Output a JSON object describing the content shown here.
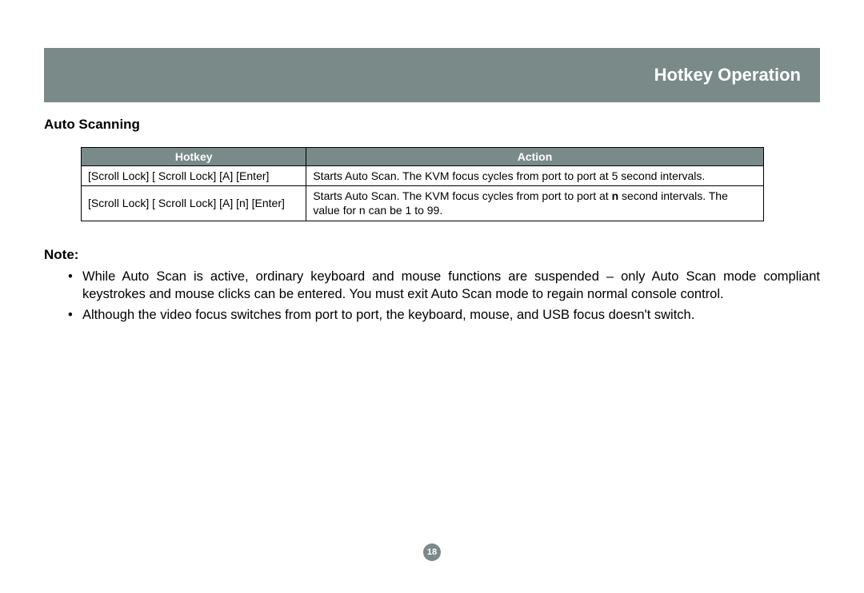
{
  "header": {
    "title": "Hotkey Operation"
  },
  "section": {
    "heading": "Auto  Scanning"
  },
  "table": {
    "headers": {
      "hotkey": "Hotkey",
      "action": "Action"
    },
    "rows": [
      {
        "hotkey": "[Scroll Lock] [ Scroll Lock] [A] [Enter]",
        "action": "Starts Auto Scan.  The KVM focus cycles from port to port at 5 second intervals."
      },
      {
        "hotkey": "[Scroll Lock] [ Scroll Lock] [A] [n] [Enter]",
        "action_prefix": "Starts Auto Scan.  The KVM focus cycles from port to port at ",
        "action_bold": "n",
        "action_suffix": " second intervals.  The value for n can be 1 to 99."
      }
    ]
  },
  "note": {
    "heading": "Note:",
    "items": [
      "While Auto Scan is active, ordinary keyboard and mouse functions are suspended – only Auto Scan mode compliant keystrokes and mouse clicks can be entered. You must exit Auto Scan mode to regain normal console control.",
      "Although the video focus switches from port to port, the keyboard, mouse, and USB focus doesn't switch."
    ]
  },
  "page_number": "18"
}
